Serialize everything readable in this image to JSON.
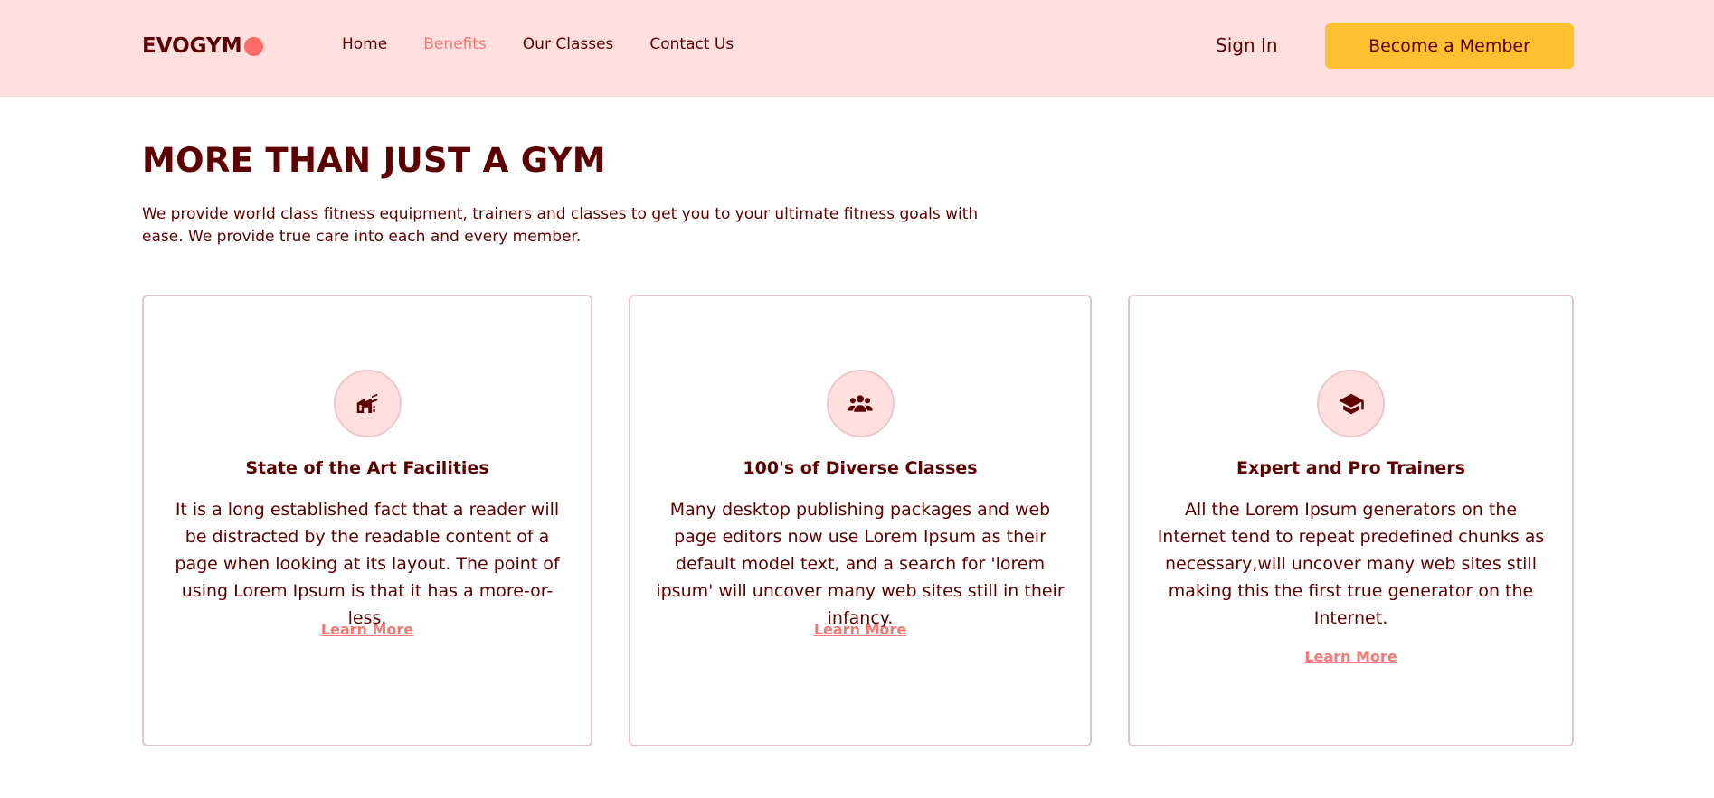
{
  "nav": {
    "logo": "EVOGYM",
    "links": [
      "Home",
      "Benefits",
      "Our Classes",
      "Contact Us"
    ],
    "active_link": "Benefits",
    "sign_in": "Sign In",
    "cta": "Become a Member"
  },
  "benefits": {
    "title": "MORE THAN JUST A GYM",
    "description": "We provide world class fitness equipment, trainers and classes to get you to your ultimate fitness goals with ease. We provide true care into each and every member.",
    "cards": [
      {
        "icon": "home-modern-icon",
        "title": "State of the Art Facilities",
        "text": "It is a long established fact that a reader will be distracted by the readable content of a page when looking at its layout. The point of using Lorem Ipsum is that it has a more-or-less.",
        "link": "Learn More"
      },
      {
        "icon": "user-group-icon",
        "title": "100's of Diverse Classes",
        "text": "Many desktop publishing packages and web page editors now use Lorem Ipsum as their default model text, and a search for 'lorem ipsum' will uncover many web sites still in their infancy.",
        "link": "Learn More"
      },
      {
        "icon": "academic-cap-icon",
        "title": "Expert and Pro Trainers",
        "text": "All the Lorem Ipsum generators on the Internet tend to repeat predefined chunks as necessary,will uncover many web sites still making this the first true generator on the Internet.",
        "link": "Learn More"
      }
    ]
  },
  "colors": {
    "primary_dark": "#5e0000",
    "nav_bg": "#ffe0df",
    "accent": "#ffc132",
    "link_accent": "#f47a76"
  }
}
